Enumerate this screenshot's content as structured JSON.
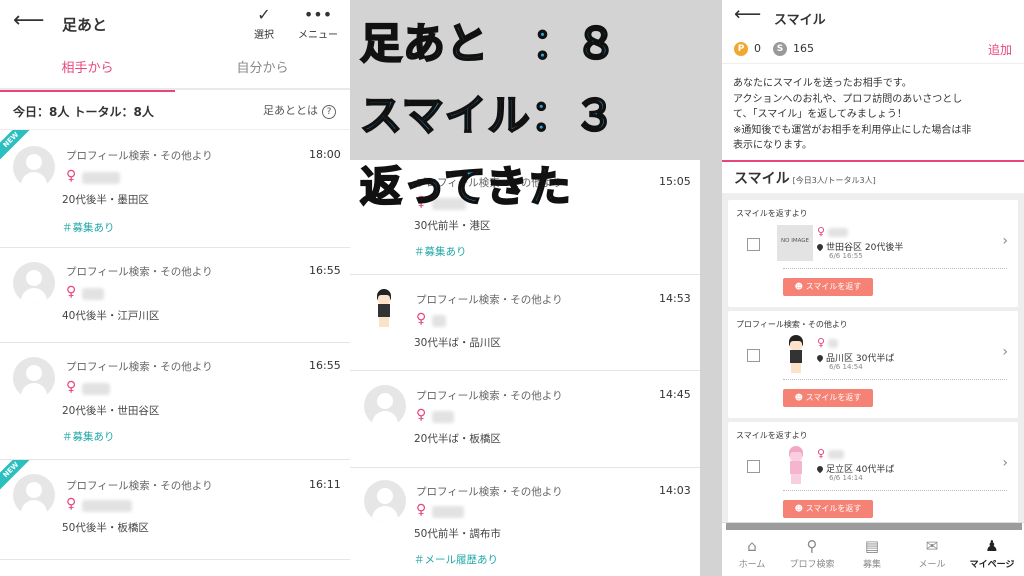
{
  "overlay": {
    "line1": "足あと　：８",
    "line2": "スマイル：３",
    "line3": "返ってきた"
  },
  "left": {
    "title": "足あと",
    "select_label": "選択",
    "menu_label": "メニュー",
    "tabs": [
      "相手から",
      "自分から"
    ],
    "totals": "今日：8人 トータル：8人",
    "help": "足あととは",
    "new_badge": "NEW",
    "items": [
      {
        "source": "プロフィール検索・その他より",
        "time": "18:00",
        "age_area": "20代後半・墨田区",
        "tag": "＃募集あり"
      },
      {
        "source": "プロフィール検索・その他より",
        "time": "16:55",
        "age_area": "40代後半・江戸川区",
        "tag": ""
      },
      {
        "source": "プロフィール検索・その他より",
        "time": "16:55",
        "age_area": "20代後半・世田谷区",
        "tag": "＃募集あり"
      },
      {
        "source": "プロフィール検索・その他より",
        "time": "16:11",
        "age_area": "50代後半・板橋区",
        "tag": ""
      }
    ]
  },
  "middle": {
    "items": [
      {
        "source": "プロフィール検索・その他より",
        "time": "15:05",
        "age_area": "30代前半・港区",
        "tag": "＃募集あり"
      },
      {
        "source": "プロフィール検索・その他より",
        "time": "14:53",
        "age_area": "30代半ば・品川区",
        "tag": ""
      },
      {
        "source": "プロフィール検索・その他より",
        "time": "14:45",
        "age_area": "20代半ば・板橋区",
        "tag": ""
      },
      {
        "source": "プロフィール検索・その他より",
        "time": "14:03",
        "age_area": "50代前半・調布市",
        "tag": "＃メール履歴あり"
      }
    ]
  },
  "right": {
    "title": "スマイル",
    "points_p": "0",
    "points_s": "165",
    "add_label": "追加",
    "desc": [
      "あなたにスマイルを送ったお相手です。",
      "アクションへのお礼や、プロフ訪問のあいさつとし",
      "て、「スマイル」を返してみましょう！",
      "※通知後でも運営がお相手を利用停止にした場合は非",
      "表示になります。"
    ],
    "smile_title": "スマイル",
    "smile_sub": "[今日3人/トータル3人]",
    "cards": [
      {
        "top": "スマイルを返すより",
        "location": "世田谷区 20代後半",
        "datetime": "6/6 16:55",
        "button": "スマイルを返す",
        "no_image": "NO IMAGE"
      },
      {
        "top": "プロフィール検索・その他より",
        "location": "品川区 30代半ば",
        "datetime": "6/6 14:54",
        "button": "スマイルを返す"
      },
      {
        "top": "スマイルを返すより",
        "location": "足立区 40代半ば",
        "datetime": "6/6 14:14",
        "button": "スマイルを返す"
      }
    ],
    "nav": [
      "ホーム",
      "プロフ検索",
      "募集",
      "メール",
      "マイページ"
    ]
  },
  "colors": {
    "accent_pink": "#e8457f",
    "tag_teal": "#22a8a8",
    "overlay_blue": "#29a8e8",
    "smile_button": "#f68275"
  }
}
